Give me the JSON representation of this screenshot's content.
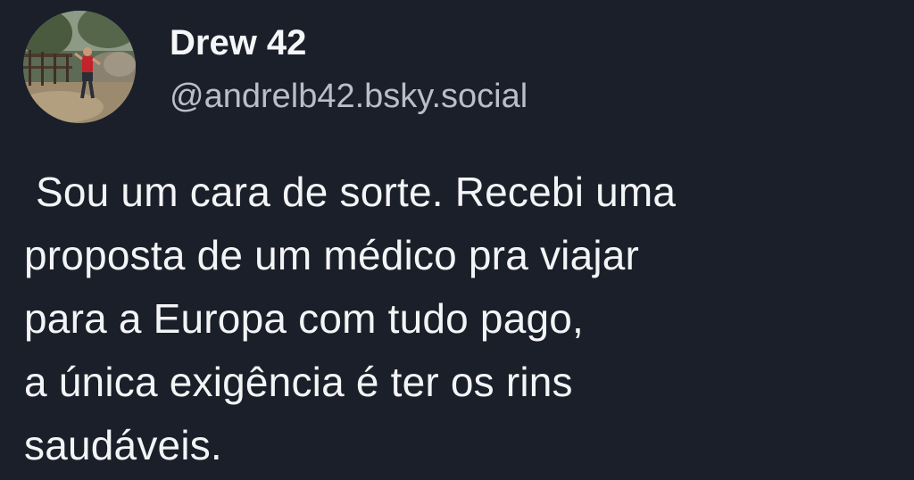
{
  "author": {
    "display_name": "Drew 42",
    "handle": "@andrelb42.bsky.social",
    "avatar_icon": "profile-photo"
  },
  "post": {
    "lines": [
      " Sou um cara de sorte. Recebi uma",
      "proposta de um médico pra viajar",
      "para a Europa com tudo pago,",
      "a única exigência é ter os rins",
      "saudáveis."
    ]
  },
  "colors": {
    "background": "#1b1f29",
    "name": "#f5f6f8",
    "handle": "#b6bfca",
    "text": "#f3f4f6"
  }
}
